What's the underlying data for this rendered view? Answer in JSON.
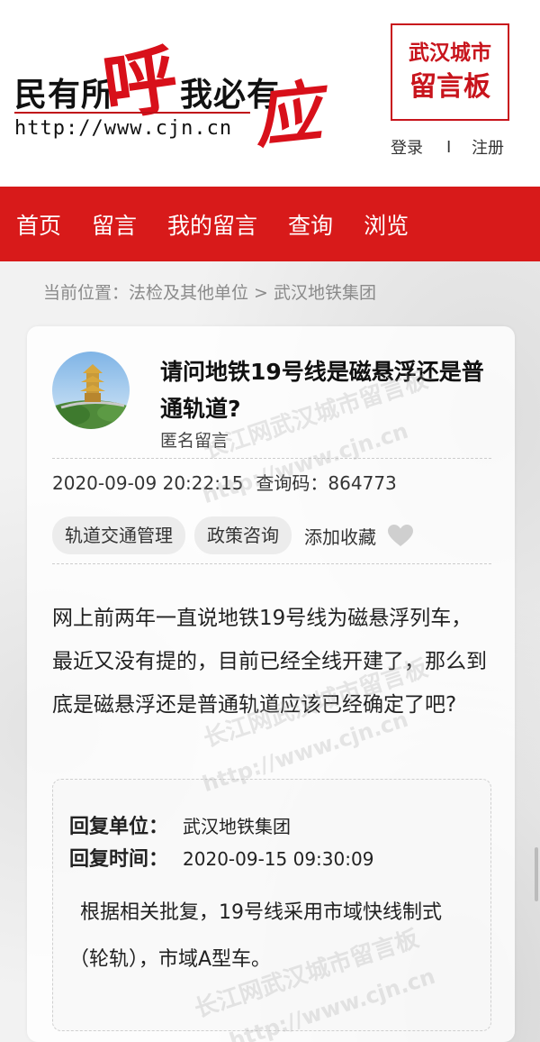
{
  "logo": {
    "slogan_left": "民有所",
    "slogan_hu": "呼",
    "slogan_right": "我必有",
    "slogan_ying": "应",
    "url": "http://www.cjn.cn"
  },
  "board": {
    "line1": "武汉城市",
    "line2": "留言板"
  },
  "auth": {
    "login": "登录",
    "separator": "I",
    "register": "注册"
  },
  "nav": {
    "items": [
      "首页",
      "留言",
      "我的留言",
      "查询",
      "浏览"
    ]
  },
  "breadcrumb": "当前位置：法检及其他单位 > 武汉地铁集团",
  "post": {
    "title": "请问地铁19号线是磁悬浮还是普通轨道?",
    "author": "匿名留言",
    "datetime": "2020-09-09 20:22:15",
    "code_label": "查询码：",
    "code": "864773",
    "tags": [
      "轨道交通管理",
      "政策咨询"
    ],
    "favorite_label": "添加收藏",
    "body": "网上前两年一直说地铁19号线为磁悬浮列车，最近又没有提的，目前已经全线开建了，那么到底是磁悬浮还是普通轨道应该已经确定了吧?"
  },
  "reply": {
    "unit_label": "回复单位：",
    "unit": "武汉地铁集团",
    "time_label": "回复时间：",
    "time": "2020-09-15 09:30:09",
    "text": "根据相关批复，19号线采用市域快线制式（轮轨），市域A型车。"
  },
  "watermark_text_1": "长江网武汉城市留言板",
  "watermark_text_2": "http://www.cjn.cn",
  "colors": {
    "brand_red": "#d81a1a",
    "logo_red": "#d8101a"
  },
  "icons": {
    "favorite": "heart-icon"
  }
}
